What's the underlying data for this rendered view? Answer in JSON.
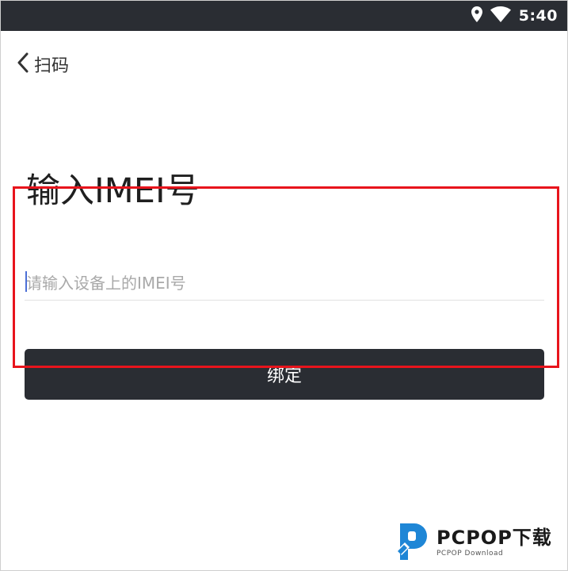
{
  "status_bar": {
    "time": "5:40",
    "icons": [
      "location-pin-icon",
      "wifi-icon"
    ]
  },
  "nav": {
    "back_icon": "back-chevron-icon",
    "title": "扫码"
  },
  "page": {
    "title": "输入IMEI号"
  },
  "imei_input": {
    "placeholder": "请输入设备上的IMEI号",
    "value": ""
  },
  "bind_button": {
    "label": "绑定"
  },
  "watermark": {
    "logo_icon": "pcpop-logo-icon",
    "brand": "PCPOP下载",
    "subtitle": "PCPOP Download"
  },
  "colors": {
    "status_bar_bg": "#2a2d33",
    "button_bg": "#2a2d33",
    "highlight_border": "#e8141c",
    "caret": "#4c6fd6"
  }
}
